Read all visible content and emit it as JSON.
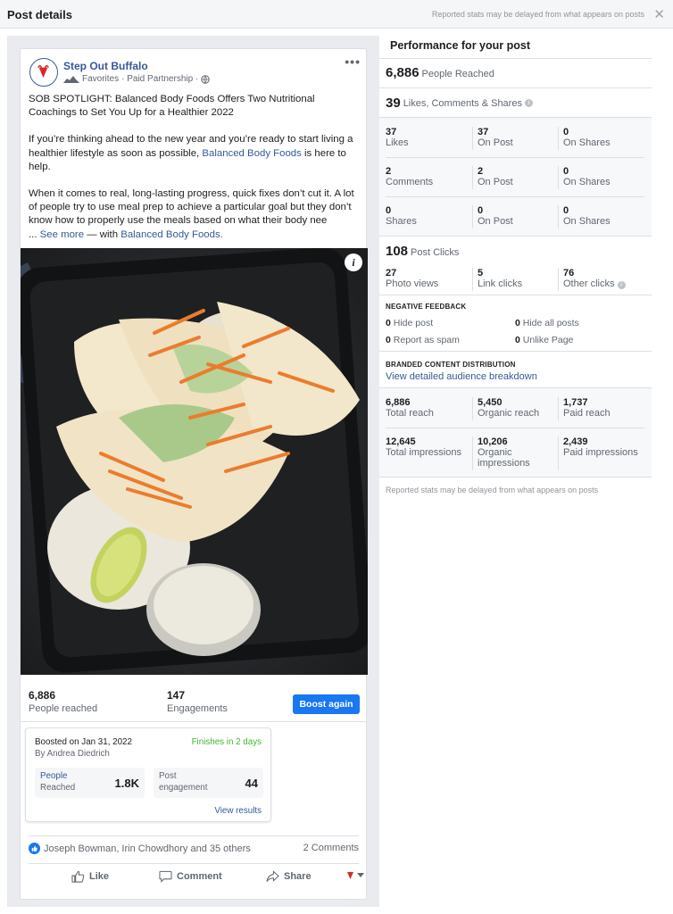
{
  "topbar": {
    "title": "Post details",
    "note": "Reported stats may be delayed from what appears on posts",
    "close_icon": "close-icon"
  },
  "post": {
    "page_name": "Step Out Buffalo",
    "sub_favorites": "Favorites",
    "sub_partnership": "· Paid Partnership ·",
    "more": "•••",
    "headline": "SOB SPOTLIGHT: Balanced Body Foods Offers Two Nutritional Coachings to Set You Up for a Healthier 2022",
    "para2_before": "If you’re thinking ahead to the new year and you’re ready to start living a healthier lifestyle as soon as possible, ",
    "para2_link": "Balanced Body Foods",
    "para2_after": " is here to help.",
    "para3": "When it comes to real, long-lasting progress, quick fixes don’t cut it. A lot of people try to use meal prep to achieve a particular goal but they don’t know how to properly use the meals based on what their body nee",
    "see_more_prefix": "... ",
    "see_more": "See more",
    "with_prefix": " — with ",
    "with_link": "Balanced Body Foods.",
    "info_glyph": "i"
  },
  "summary": {
    "reached_value": "6,886",
    "reached_label": "People reached",
    "engagements_value": "147",
    "engagements_label": "Engagements",
    "boost_again": "Boost again"
  },
  "boost": {
    "date": "Boosted on Jan 31, 2022",
    "by": "By Andrea Diedrich",
    "finish": "Finishes in 2 days",
    "tile1_l1": "People",
    "tile1_l2": "Reached",
    "tile1_value": "1.8K",
    "tile2_l1": "Post",
    "tile2_l2": "engagement",
    "tile2_value": "44",
    "view_results": "View results"
  },
  "social": {
    "reactors": "Joseph Bowman, Irin Chowdhory and 35 others",
    "comments": "2 Comments",
    "like": "Like",
    "comment": "Comment",
    "share": "Share"
  },
  "performance": {
    "title": "Performance for your post",
    "people_reached_value": "6,886",
    "people_reached_label": "People Reached",
    "lcs_value": "39",
    "lcs_label": "Likes, Comments & Shares",
    "grid": [
      [
        {
          "n": "37",
          "t": "Likes"
        },
        {
          "n": "37",
          "t": "On Post"
        },
        {
          "n": "0",
          "t": "On Shares"
        }
      ],
      [
        {
          "n": "2",
          "t": "Comments"
        },
        {
          "n": "2",
          "t": "On Post"
        },
        {
          "n": "0",
          "t": "On Shares"
        }
      ],
      [
        {
          "n": "0",
          "t": "Shares"
        },
        {
          "n": "0",
          "t": "On Post"
        },
        {
          "n": "0",
          "t": "On Shares"
        }
      ]
    ],
    "post_clicks_value": "108",
    "post_clicks_label": "Post Clicks",
    "clicks": [
      {
        "n": "27",
        "t": "Photo views"
      },
      {
        "n": "5",
        "t": "Link clicks"
      },
      {
        "n": "76",
        "t": "Other clicks"
      }
    ],
    "negative_title": "NEGATIVE FEEDBACK",
    "negative": [
      {
        "n": "0",
        "t": "Hide post"
      },
      {
        "n": "0",
        "t": "Hide all posts"
      },
      {
        "n": "0",
        "t": "Report as spam"
      },
      {
        "n": "0",
        "t": "Unlike Page"
      }
    ],
    "branded_title": "BRANDED CONTENT DISTRIBUTION",
    "branded_link": "View detailed audience breakdown",
    "reach_grid": [
      {
        "n": "6,886",
        "t": "Total reach"
      },
      {
        "n": "5,450",
        "t": "Organic reach"
      },
      {
        "n": "1,737",
        "t": "Paid reach"
      }
    ],
    "impr_grid": [
      {
        "n": "12,645",
        "t": "Total impressions"
      },
      {
        "n": "10,206",
        "t": "Organic impressions"
      },
      {
        "n": "2,439",
        "t": "Paid impressions"
      }
    ],
    "footer": "Reported stats may be delayed from what appears on posts"
  }
}
